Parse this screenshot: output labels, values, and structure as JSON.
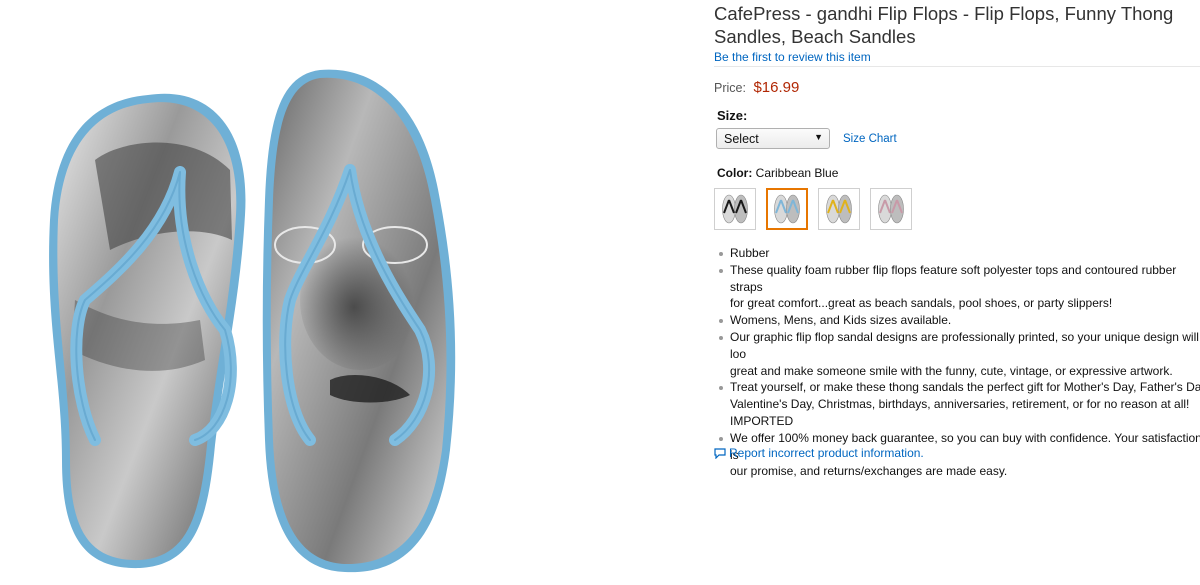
{
  "product": {
    "title": "CafePress - gandhi Flip Flops - Flip Flops, Funny Thong Sandles, Beach Sandles",
    "review_link": "Be the first to review this item",
    "price_label": "Price:",
    "price": "$16.99",
    "size_label": "Size:",
    "size_selected": "Select",
    "size_chart": "Size Chart",
    "color_label": "Color:",
    "color_value": "Caribbean Blue",
    "swatches": [
      {
        "strap": "#1a1a1a",
        "selected": false
      },
      {
        "strap": "#7fb6d8",
        "selected": true
      },
      {
        "strap": "#e0b21c",
        "selected": false
      },
      {
        "strap": "#c89aa8",
        "selected": false
      }
    ],
    "bullets": [
      "Rubber",
      "These quality foam rubber flip flops feature soft polyester tops and contoured rubber straps\nfor great comfort...great as beach sandals, pool shoes, or party slippers!",
      "Womens, Mens, and Kids sizes available.",
      "Our graphic flip flop sandal designs are professionally printed, so your unique design will loo\ngreat and make someone smile with the funny, cute, vintage, or expressive artwork.",
      "Treat yourself, or make these thong sandals the perfect gift for Mother's Day, Father's Day,\nValentine's Day, Christmas, birthdays, anniversaries, retirement, or for no reason at all!\nIMPORTED",
      "We offer 100% money back guarantee, so you can buy with confidence. Your satisfaction is\nour promise, and returns/exchanges are made easy."
    ],
    "report_link": "Report incorrect product information.",
    "accent_colors": {
      "link": "#0066c0",
      "price": "#b12704",
      "strap": "#7fb6d8",
      "selected_border": "#e77600"
    },
    "icons": [
      "flip-flop-image",
      "chevron-down-icon",
      "comment-icon"
    ]
  }
}
